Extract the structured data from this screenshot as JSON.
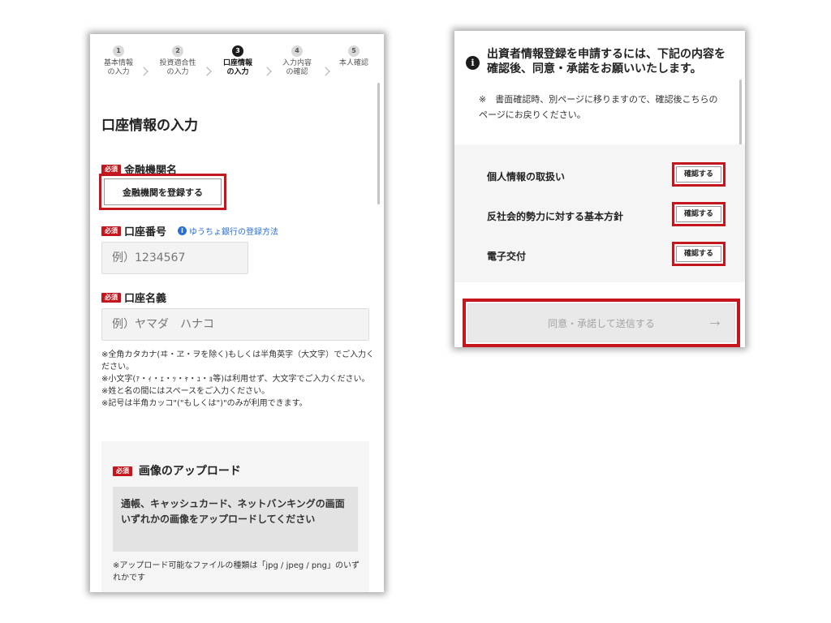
{
  "left": {
    "steps": [
      {
        "num": "1",
        "label": "基本情報\nの入力"
      },
      {
        "num": "2",
        "label": "投資適合性\nの入力"
      },
      {
        "num": "3",
        "label": "口座情報\nの入力"
      },
      {
        "num": "4",
        "label": "入力内容\nの確認"
      },
      {
        "num": "5",
        "label": "本人確認"
      }
    ],
    "page_title": "口座情報の入力",
    "required_label": "必須",
    "bank_name_label": "金融機関名",
    "register_bank_button": "金融機関を登録する",
    "account_number_label": "口座番号",
    "yucho_link": "ゆうちょ銀行の登録方法",
    "info_glyph": "i",
    "account_number_placeholder": "例）1234567",
    "account_name_label": "口座名義",
    "account_name_placeholder": "例）ヤマダ　ハナコ",
    "notes": [
      "※全角カタカナ(ヰ・ヱ・ヲを除く)もしくは半角英字（大文字）でご入力ください。",
      "※小文字(ｧ・ｨ・ｪ・ｯ・ｬ・ｭ・ｮ等)は利用せず、大文字でご入力ください。",
      "※姓と名の間にはスペースをご入力ください。",
      "※記号は半角カッコ\"(\"もしくは\")\"のみが利用できます。"
    ],
    "upload_title": "画像のアップロード",
    "upload_description": "通帳、キャッシュカード、ネットバンキングの画面いずれかの画像をアップロードしてください",
    "upload_note": "※アップロード可能なファイルの種類は「jpg / jpeg / png」のいずれかです"
  },
  "right": {
    "notice_glyph": "i",
    "notice_heading": "出資者情報登録を申請するには、下記の内容を確認後、同意・承諾をお願いいたします。",
    "notice_sub": "※　書面確認時、別ページに移りますので、確認後こちらのページにお戻りください。",
    "documents": [
      {
        "label": "個人情報の取扱い",
        "button": "確認する"
      },
      {
        "label": "反社会的勢力に対する基本方針",
        "button": "確認する"
      },
      {
        "label": "電子交付",
        "button": "確認する"
      }
    ],
    "submit_button": "同意・承諾して送信する",
    "submit_arrow": "→"
  },
  "colors": {
    "highlight_red": "#c4161c",
    "required_badge": "#c4161c",
    "link_blue": "#2a6fdb",
    "active_step": "#1c1c1c"
  }
}
